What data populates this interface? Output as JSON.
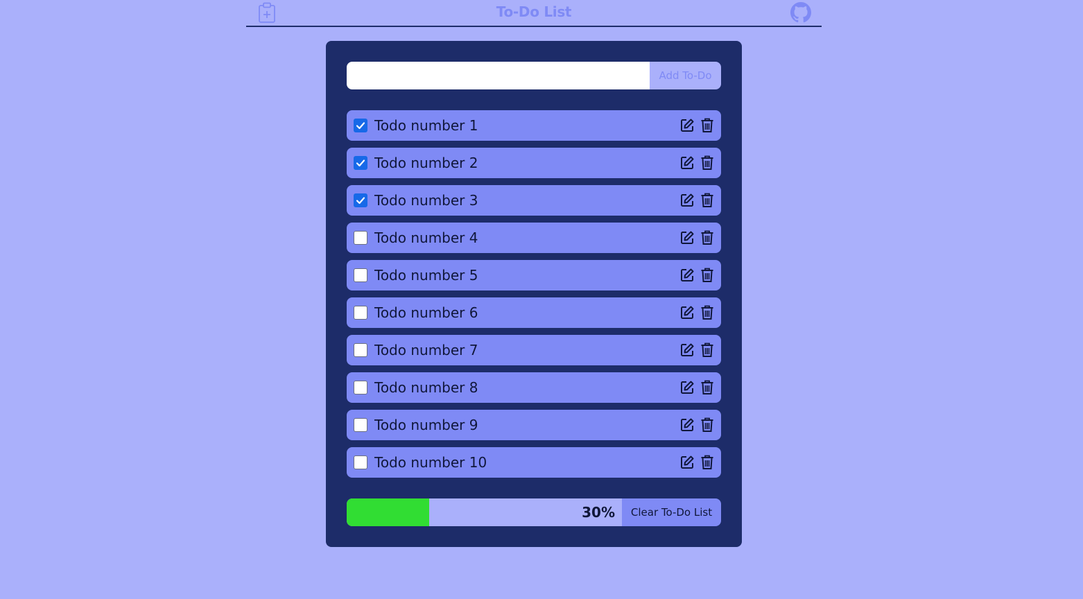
{
  "header": {
    "title": "To-Do List",
    "left_icon": "clipboard-plus-icon",
    "right_icon": "github-icon"
  },
  "add": {
    "input_value": "",
    "button_label": "Add To-Do"
  },
  "todos": [
    {
      "label": "Todo number 1",
      "checked": true
    },
    {
      "label": "Todo number 2",
      "checked": true
    },
    {
      "label": "Todo number 3",
      "checked": true
    },
    {
      "label": "Todo number 4",
      "checked": false
    },
    {
      "label": "Todo number 5",
      "checked": false
    },
    {
      "label": "Todo number 6",
      "checked": false
    },
    {
      "label": "Todo number 7",
      "checked": false
    },
    {
      "label": "Todo number 8",
      "checked": false
    },
    {
      "label": "Todo number 9",
      "checked": false
    },
    {
      "label": "Todo number 10",
      "checked": false
    }
  ],
  "item_icons": [
    "edit-icon",
    "trash-icon"
  ],
  "progress": {
    "fraction": 0.3,
    "text": "30%"
  },
  "clear_button_label": "Clear To-Do List",
  "colors": {
    "page_background": "#aab0fb",
    "panel": "#1d2c69",
    "item": "#7f8af5",
    "progress_fill": "#31dd33",
    "checkbox_checked": "#1769e8"
  }
}
